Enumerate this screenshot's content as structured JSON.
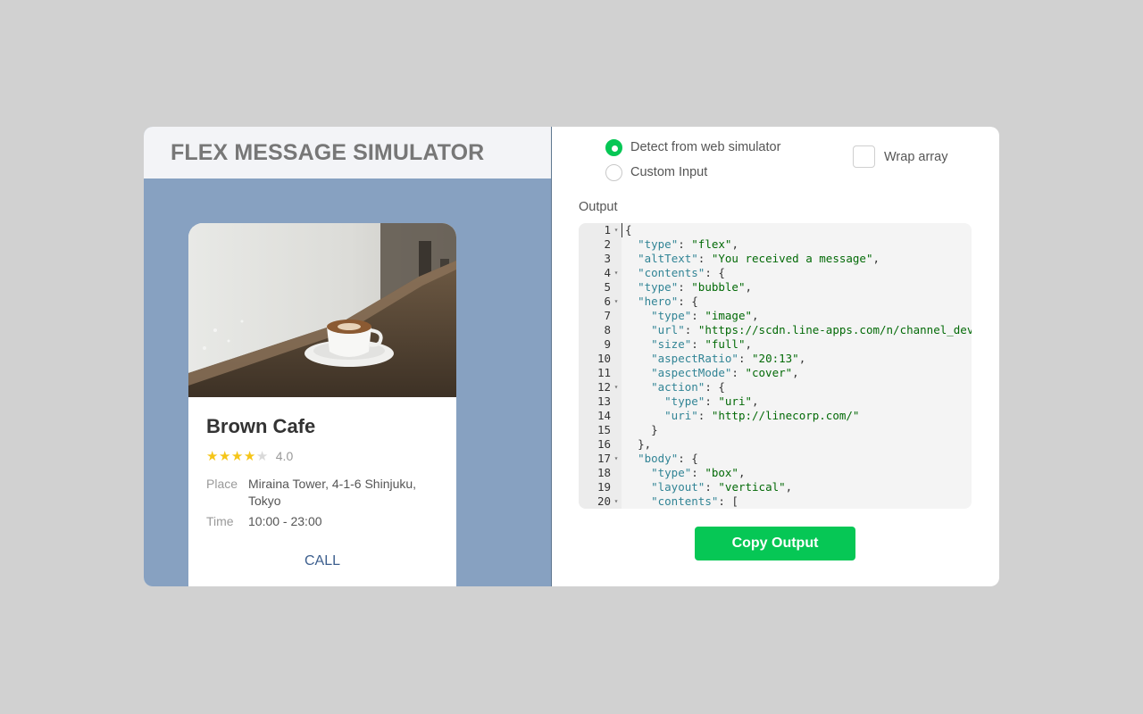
{
  "app": {
    "title": "FLEX MESSAGE SIMULATOR"
  },
  "bubble": {
    "name": "Brown Cafe",
    "rating": {
      "stars_filled": 4,
      "stars_total": 5,
      "value": "4.0"
    },
    "place_label": "Place",
    "place_value": "Miraina Tower, 4-1-6 Shinjuku, Tokyo",
    "time_label": "Time",
    "time_value": "10:00 - 23:00",
    "call_label": "CALL",
    "hero_icon": "coffee-cup-photo"
  },
  "options": {
    "radios": [
      {
        "label": "Detect from web simulator",
        "checked": true
      },
      {
        "label": "Custom Input",
        "checked": false
      }
    ],
    "wrap_array": {
      "label": "Wrap array",
      "checked": false
    }
  },
  "output": {
    "label": "Output",
    "lines": [
      {
        "n": "1",
        "fold": true,
        "indent": 0,
        "parts": [
          [
            "p",
            "{"
          ]
        ]
      },
      {
        "n": "2",
        "fold": false,
        "indent": 2,
        "parts": [
          [
            "k",
            "\"type\""
          ],
          [
            "p",
            ": "
          ],
          [
            "s",
            "\"flex\""
          ],
          [
            "p",
            ","
          ]
        ]
      },
      {
        "n": "3",
        "fold": false,
        "indent": 2,
        "parts": [
          [
            "k",
            "\"altText\""
          ],
          [
            "p",
            ": "
          ],
          [
            "s",
            "\"You received a message\""
          ],
          [
            "p",
            ","
          ]
        ]
      },
      {
        "n": "4",
        "fold": true,
        "indent": 2,
        "parts": [
          [
            "k",
            "\"contents\""
          ],
          [
            "p",
            ": {"
          ]
        ]
      },
      {
        "n": "5",
        "fold": false,
        "indent": 2,
        "parts": [
          [
            "k",
            "\"type\""
          ],
          [
            "p",
            ": "
          ],
          [
            "s",
            "\"bubble\""
          ],
          [
            "p",
            ","
          ]
        ]
      },
      {
        "n": "6",
        "fold": true,
        "indent": 2,
        "parts": [
          [
            "k",
            "\"hero\""
          ],
          [
            "p",
            ": {"
          ]
        ]
      },
      {
        "n": "7",
        "fold": false,
        "indent": 4,
        "parts": [
          [
            "k",
            "\"type\""
          ],
          [
            "p",
            ": "
          ],
          [
            "s",
            "\"image\""
          ],
          [
            "p",
            ","
          ]
        ]
      },
      {
        "n": "8",
        "fold": false,
        "indent": 4,
        "parts": [
          [
            "k",
            "\"url\""
          ],
          [
            "p",
            ": "
          ],
          [
            "s",
            "\"https://scdn.line-apps.com/n/channel_devc"
          ]
        ]
      },
      {
        "n": "9",
        "fold": false,
        "indent": 4,
        "parts": [
          [
            "k",
            "\"size\""
          ],
          [
            "p",
            ": "
          ],
          [
            "s",
            "\"full\""
          ],
          [
            "p",
            ","
          ]
        ]
      },
      {
        "n": "10",
        "fold": false,
        "indent": 4,
        "parts": [
          [
            "k",
            "\"aspectRatio\""
          ],
          [
            "p",
            ": "
          ],
          [
            "s",
            "\"20:13\""
          ],
          [
            "p",
            ","
          ]
        ]
      },
      {
        "n": "11",
        "fold": false,
        "indent": 4,
        "parts": [
          [
            "k",
            "\"aspectMode\""
          ],
          [
            "p",
            ": "
          ],
          [
            "s",
            "\"cover\""
          ],
          [
            "p",
            ","
          ]
        ]
      },
      {
        "n": "12",
        "fold": true,
        "indent": 4,
        "parts": [
          [
            "k",
            "\"action\""
          ],
          [
            "p",
            ": {"
          ]
        ]
      },
      {
        "n": "13",
        "fold": false,
        "indent": 6,
        "parts": [
          [
            "k",
            "\"type\""
          ],
          [
            "p",
            ": "
          ],
          [
            "s",
            "\"uri\""
          ],
          [
            "p",
            ","
          ]
        ]
      },
      {
        "n": "14",
        "fold": false,
        "indent": 6,
        "parts": [
          [
            "k",
            "\"uri\""
          ],
          [
            "p",
            ": "
          ],
          [
            "s",
            "\"http://linecorp.com/\""
          ]
        ]
      },
      {
        "n": "15",
        "fold": false,
        "indent": 4,
        "parts": [
          [
            "p",
            "}"
          ]
        ]
      },
      {
        "n": "16",
        "fold": false,
        "indent": 2,
        "parts": [
          [
            "p",
            "},"
          ]
        ]
      },
      {
        "n": "17",
        "fold": true,
        "indent": 2,
        "parts": [
          [
            "k",
            "\"body\""
          ],
          [
            "p",
            ": {"
          ]
        ]
      },
      {
        "n": "18",
        "fold": false,
        "indent": 4,
        "parts": [
          [
            "k",
            "\"type\""
          ],
          [
            "p",
            ": "
          ],
          [
            "s",
            "\"box\""
          ],
          [
            "p",
            ","
          ]
        ]
      },
      {
        "n": "19",
        "fold": false,
        "indent": 4,
        "parts": [
          [
            "k",
            "\"layout\""
          ],
          [
            "p",
            ": "
          ],
          [
            "s",
            "\"vertical\""
          ],
          [
            "p",
            ","
          ]
        ]
      },
      {
        "n": "20",
        "fold": true,
        "indent": 4,
        "parts": [
          [
            "k",
            "\"contents\""
          ],
          [
            "p",
            ": ["
          ]
        ]
      }
    ],
    "copy_label": "Copy Output"
  },
  "colors": {
    "accent_green": "#06c755",
    "simulator_bg": "#87a1c1",
    "star": "#f5c518",
    "json_key": "#318495",
    "json_string": "#036a07",
    "call_link": "#3d5f8e"
  }
}
